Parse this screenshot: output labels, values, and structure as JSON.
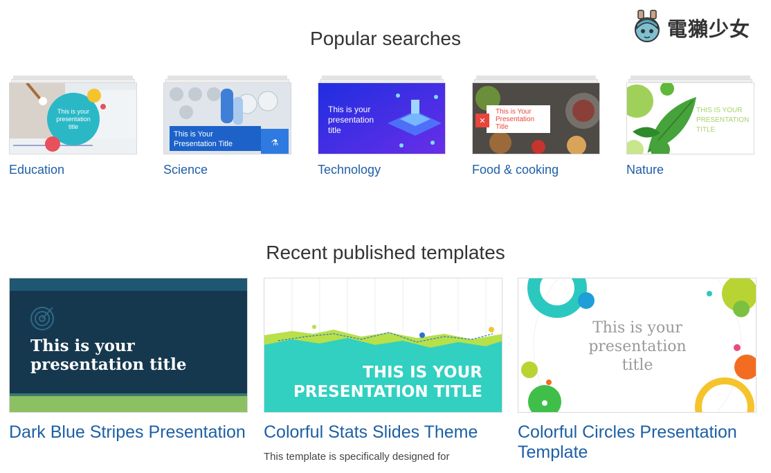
{
  "brand": {
    "name": "電獺少女"
  },
  "popular": {
    "title": "Popular searches",
    "items": [
      {
        "label": "Education",
        "thumb_text": "This is your presentation title"
      },
      {
        "label": "Science",
        "thumb_text": "This is Your Presentation Title"
      },
      {
        "label": "Technology",
        "thumb_text": "This is your presentation title"
      },
      {
        "label": "Food & cooking",
        "thumb_text": "This is Your Presentation Title"
      },
      {
        "label": "Nature",
        "thumb_text": "THIS IS YOUR PRESENTATION TITLE"
      }
    ]
  },
  "recent": {
    "title": "Recent published templates",
    "items": [
      {
        "title": "Dark Blue Stripes Presentation",
        "thumb_text": "This is your presentation title",
        "desc": ""
      },
      {
        "title": "Colorful Stats Slides Theme",
        "thumb_text": "THIS IS YOUR PRESENTATION TITLE",
        "desc": "This template is specifically designed for"
      },
      {
        "title": "Colorful Circles Presentation Template",
        "thumb_text": "This is your presentation title",
        "desc": ""
      }
    ]
  },
  "colors": {
    "link": "#1d5fa5",
    "heading": "#333333"
  }
}
